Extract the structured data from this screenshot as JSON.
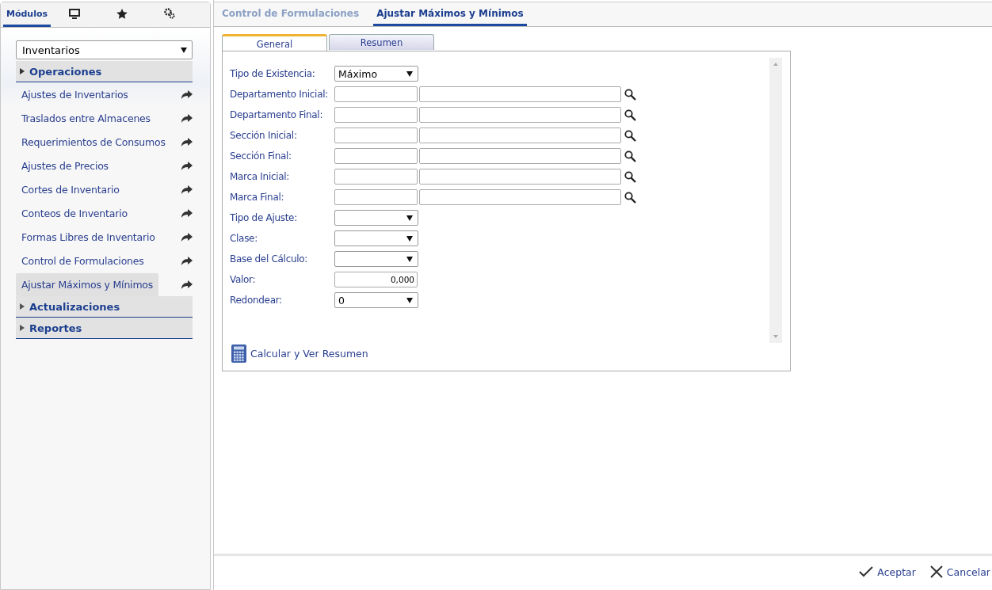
{
  "sidebar": {
    "tabs": [
      {
        "kind": "text",
        "label": "Módulos",
        "selected": true
      },
      {
        "kind": "monitor",
        "selected": false
      },
      {
        "kind": "star",
        "selected": false
      },
      {
        "kind": "gears",
        "selected": false
      }
    ],
    "module_select": {
      "value": "Inventarios"
    },
    "sections": [
      {
        "title": "Operaciones",
        "expanded": true,
        "items": [
          {
            "label": "Ajustes de Inventarios",
            "selected": false
          },
          {
            "label": "Traslados entre Almacenes",
            "selected": false
          },
          {
            "label": "Requerimientos de Consumos",
            "selected": false
          },
          {
            "label": "Ajustes de Precios",
            "selected": false
          },
          {
            "label": "Cortes de Inventario",
            "selected": false
          },
          {
            "label": "Conteos de Inventario",
            "selected": false
          },
          {
            "label": "Formas Libres de Inventario",
            "selected": false
          },
          {
            "label": "Control de Formulaciones",
            "selected": false
          },
          {
            "label": "Ajustar Máximos y Mínimos",
            "selected": true
          }
        ]
      },
      {
        "title": "Actualizaciones",
        "expanded": false
      },
      {
        "title": "Reportes",
        "expanded": false
      }
    ]
  },
  "doc_tabs": [
    {
      "label": "Control de Formulaciones",
      "selected": false
    },
    {
      "label": "Ajustar Máximos y Mínimos",
      "selected": true
    }
  ],
  "form_tabs": [
    {
      "label": "General",
      "selected": true
    },
    {
      "label": "Resumen",
      "selected": false
    }
  ],
  "fields": [
    {
      "kind": "select",
      "label": "Tipo de Existencia:",
      "value": "Máximo"
    },
    {
      "kind": "lookup",
      "label": "Departamento Inicial:"
    },
    {
      "kind": "lookup",
      "label": "Departamento Final:"
    },
    {
      "kind": "lookup",
      "label": "Sección Inicial:"
    },
    {
      "kind": "lookup",
      "label": "Sección Final:"
    },
    {
      "kind": "lookup",
      "label": "Marca Inicial:"
    },
    {
      "kind": "lookup",
      "label": "Marca Final:"
    },
    {
      "kind": "select",
      "label": "Tipo de Ajuste:"
    },
    {
      "kind": "select",
      "label": "Clase:"
    },
    {
      "kind": "select",
      "label": "Base del Cálculo:"
    },
    {
      "kind": "number",
      "label": "Valor:",
      "value": "0,000"
    },
    {
      "kind": "select",
      "label": "Redondear:",
      "value": "0"
    }
  ],
  "calc_link": "Calcular y Ver Resumen",
  "footer": {
    "accept": "Aceptar",
    "cancel": "Cancelar"
  }
}
